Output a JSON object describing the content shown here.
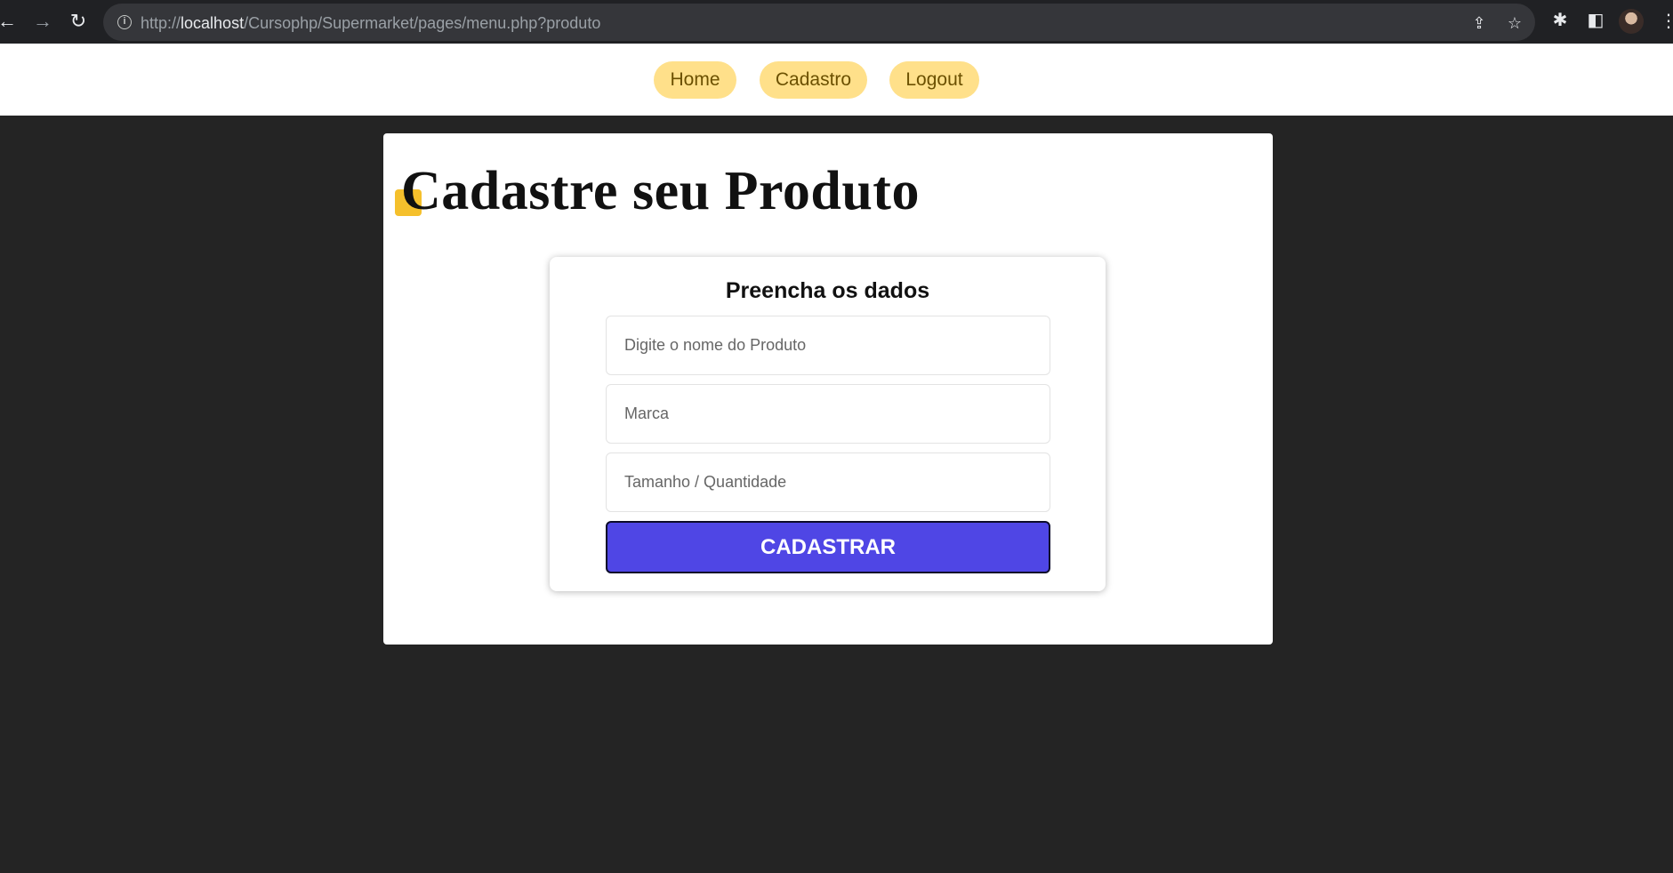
{
  "browser": {
    "url_prefix": "http://",
    "url_host": "localhost",
    "url_path": "/Cursophp/Supermarket/pages/menu.php?produto"
  },
  "nav": {
    "items": [
      {
        "label": "Home"
      },
      {
        "label": "Cadastro"
      },
      {
        "label": "Logout"
      }
    ]
  },
  "page": {
    "title": "Cadastre seu Produto"
  },
  "form": {
    "heading": "Preencha os dados",
    "fields": [
      {
        "placeholder": "Digite o nome do Produto",
        "value": ""
      },
      {
        "placeholder": "Marca",
        "value": ""
      },
      {
        "placeholder": "Tamanho / Quantidade",
        "value": ""
      }
    ],
    "submit_label": "CADASTRAR"
  },
  "colors": {
    "pill_bg": "#ffe08a",
    "accent": "#4f46e5",
    "title_mark": "#f5c02c",
    "background": "#242424"
  }
}
